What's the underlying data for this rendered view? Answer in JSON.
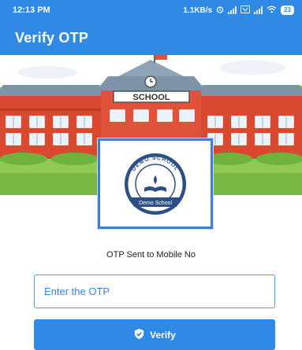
{
  "status_bar": {
    "time": "12:13 PM",
    "network_speed": "1.1KB/s",
    "battery_level": "23"
  },
  "app_bar": {
    "title": "Verify OTP"
  },
  "hero": {
    "school_sign": "SCHOOL"
  },
  "logo": {
    "ring_text": "DEMO SCHOOL",
    "ribbon_text": "Demo School"
  },
  "form": {
    "otp_sent_label": "OTP Sent to Mobile No",
    "otp_placeholder": "Enter the OTP",
    "otp_value": "",
    "verify_label": "Verify"
  },
  "colors": {
    "primary": "#2f8ae5",
    "building_red": "#d9492f",
    "roof_gray": "#7d94a8"
  },
  "icons": {
    "verify": "shield-check-icon",
    "wifi": "wifi-icon",
    "battery": "battery-icon"
  }
}
